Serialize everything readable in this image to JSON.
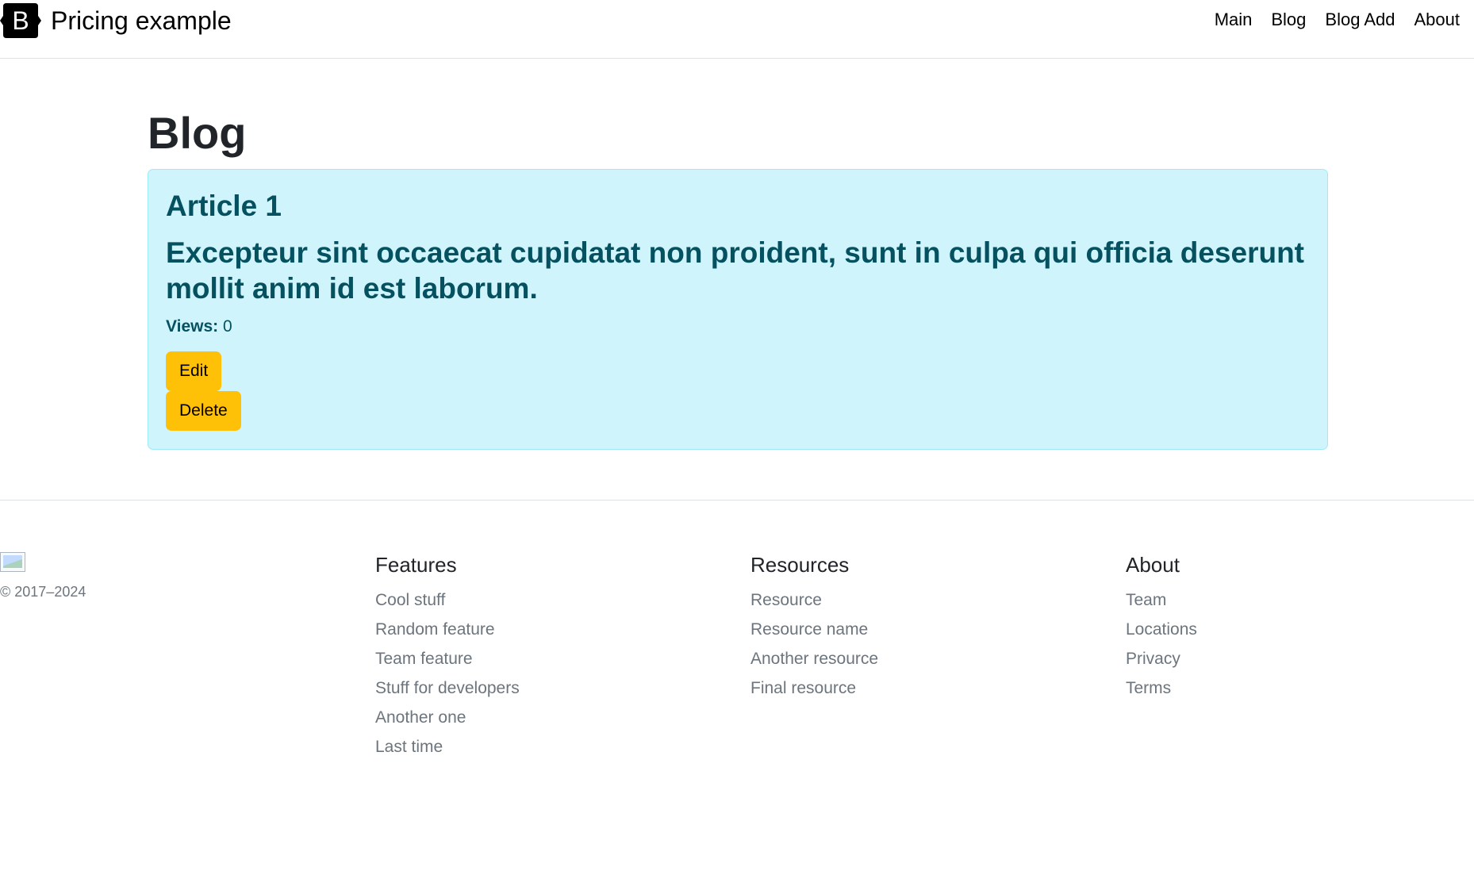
{
  "header": {
    "brand_letter": "B",
    "brand_text": "Pricing example",
    "nav": [
      "Main",
      "Blog",
      "Blog Add",
      "About"
    ]
  },
  "main": {
    "title": "Blog",
    "article": {
      "title": "Article 1",
      "body": "Excepteur sint occaecat cupidatat non proident, sunt in culpa qui officia deserunt mollit anim id est laborum.",
      "views_label": "Views:",
      "views_value": "0",
      "edit_label": "Edit",
      "delete_label": "Delete"
    }
  },
  "footer": {
    "copyright": "© 2017–2024",
    "columns": [
      {
        "heading": "Features",
        "links": [
          "Cool stuff",
          "Random feature",
          "Team feature",
          "Stuff for developers",
          "Another one",
          "Last time"
        ]
      },
      {
        "heading": "Resources",
        "links": [
          "Resource",
          "Resource name",
          "Another resource",
          "Final resource"
        ]
      },
      {
        "heading": "About",
        "links": [
          "Team",
          "Locations",
          "Privacy",
          "Terms"
        ]
      }
    ]
  },
  "colors": {
    "card_bg": "#cff4fc",
    "card_border": "#9eeaf9",
    "card_text": "#055160",
    "button_warning": "#ffc107",
    "muted_text": "#6c757d"
  },
  "icons": {
    "brand": "bootstrap-logo-icon",
    "footer_logo": "broken-image-icon"
  }
}
